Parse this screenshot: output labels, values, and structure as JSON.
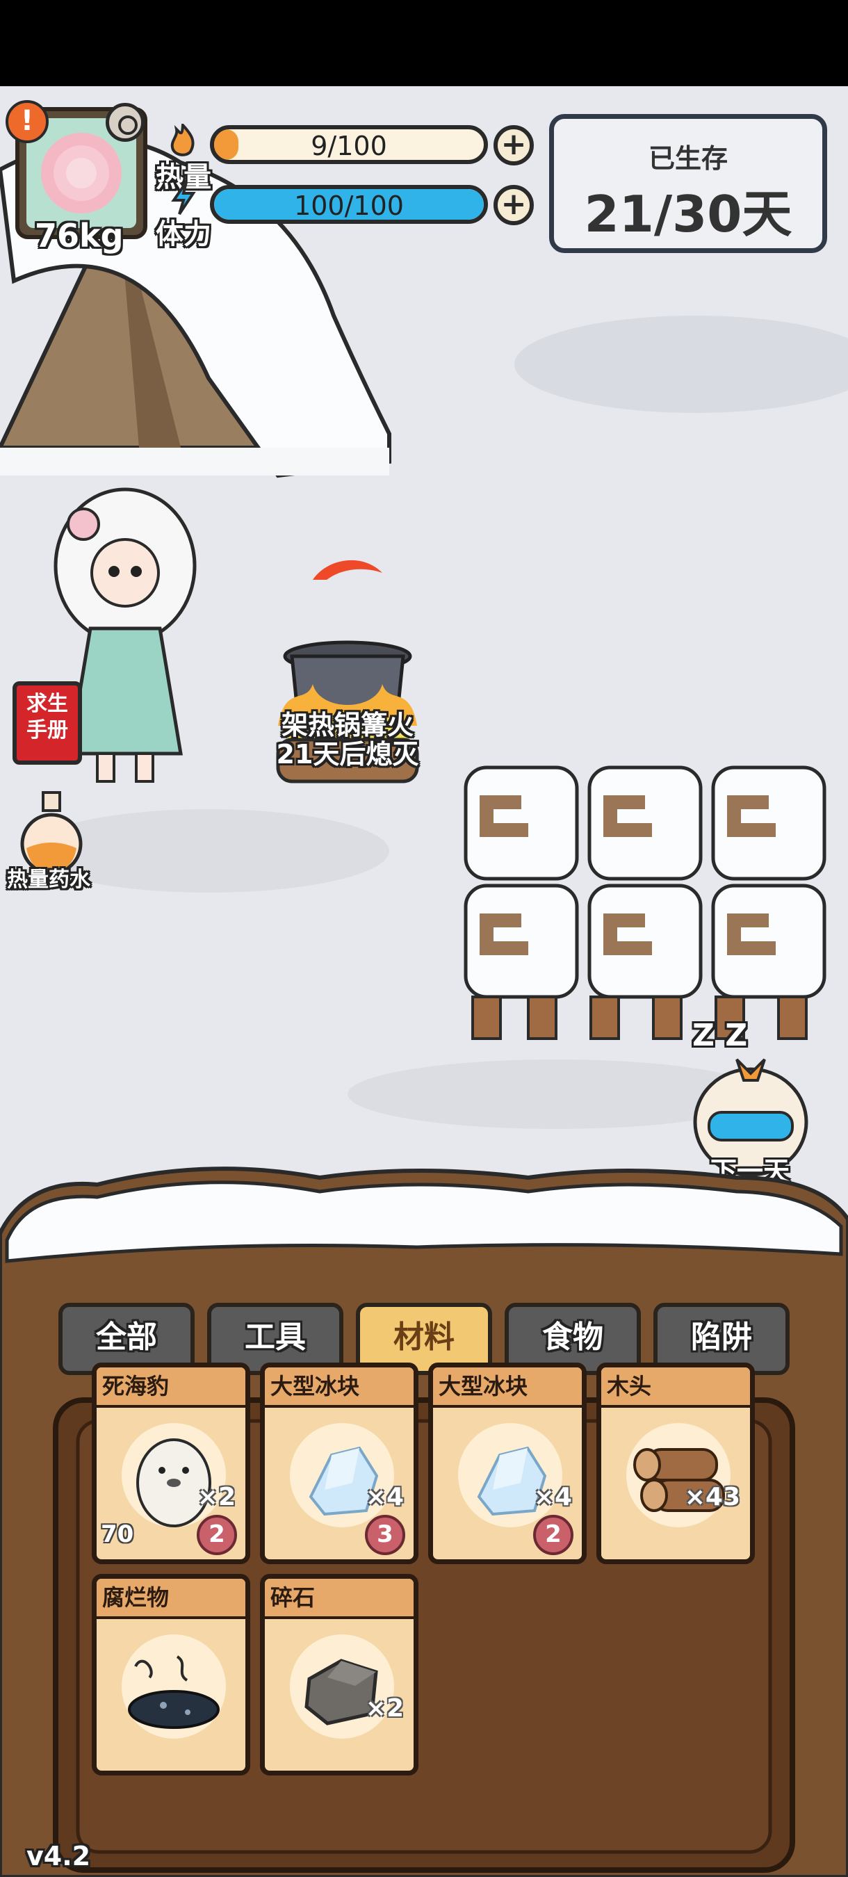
{
  "hud": {
    "weight": "76kg",
    "heat_label": "热量",
    "heat_value": "9/100",
    "heat_fill": 0.09,
    "stamina_label": "体力",
    "stamina_value": "100/100",
    "stamina_fill": 1.0,
    "alert_glyph": "!",
    "plus_glyph": "+"
  },
  "survival": {
    "label": "已生存",
    "days": "21/30天"
  },
  "campfire": {
    "line1": "架热锅篝火",
    "line2": "21天后熄灭"
  },
  "side": {
    "manual_label": "求生手册",
    "potion_label": "热量药水"
  },
  "next_day_label": "下一天",
  "zzz": "Z Z",
  "tabs": [
    "全部",
    "工具",
    "材料",
    "食物",
    "陷阱"
  ],
  "active_tab": "材料",
  "items": [
    {
      "name": "死海豹",
      "qty": "×2",
      "badge": "2",
      "tag": "70",
      "icon": "seal-icon"
    },
    {
      "name": "大型冰块",
      "qty": "×4",
      "badge": "3",
      "icon": "ice-block-icon"
    },
    {
      "name": "大型冰块",
      "qty": "×4",
      "badge": "2",
      "icon": "ice-block-icon"
    },
    {
      "name": "木头",
      "qty": "×43",
      "icon": "wood-log-icon"
    },
    {
      "name": "腐烂物",
      "qty": "",
      "icon": "rotten-matter-icon"
    },
    {
      "name": "碎石",
      "qty": "×2",
      "icon": "rubble-stone-icon"
    }
  ],
  "version": "v4.2",
  "colors": {
    "heat": "#f29a3a",
    "stamina": "#2fb3e8",
    "active_tab": "#f2c873",
    "tab": "#5a5a5a"
  }
}
